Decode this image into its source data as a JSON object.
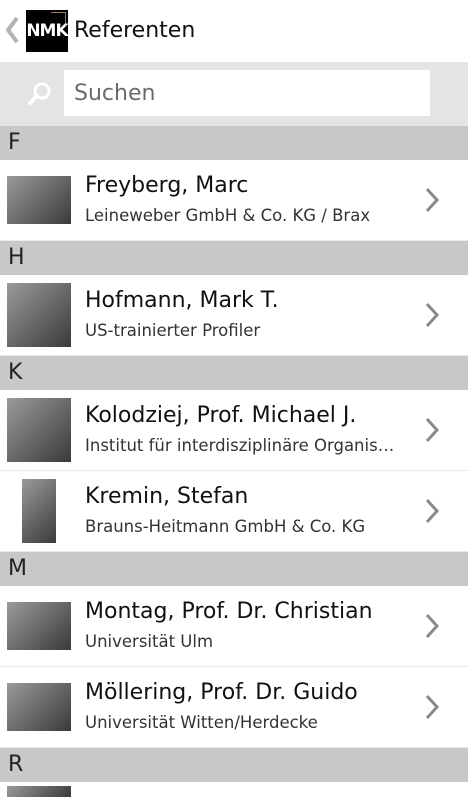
{
  "header": {
    "title": "Referenten",
    "logo_text": "NMK"
  },
  "search": {
    "placeholder": "Suchen"
  },
  "sections": [
    {
      "letter": "F",
      "people": [
        {
          "name": "Freyberg, Marc",
          "subtitle": "Leineweber GmbH & Co. KG / Brax"
        }
      ]
    },
    {
      "letter": "H",
      "people": [
        {
          "name": "Hofmann, Mark T.",
          "subtitle": "US-trainierter Profiler"
        }
      ]
    },
    {
      "letter": "K",
      "people": [
        {
          "name": "Kolodziej, Prof. Michael J.",
          "subtitle": "Institut für interdisziplinäre Organisationsentwicklung"
        },
        {
          "name": "Kremin, Stefan",
          "subtitle": "Brauns-Heitmann GmbH & Co. KG"
        }
      ]
    },
    {
      "letter": "M",
      "people": [
        {
          "name": "Montag, Prof. Dr. Christian",
          "subtitle": "Universität Ulm"
        },
        {
          "name": "Möllering, Prof. Dr. Guido",
          "subtitle": "Universität Witten/Herdecke"
        }
      ]
    },
    {
      "letter": "R",
      "people": []
    }
  ]
}
